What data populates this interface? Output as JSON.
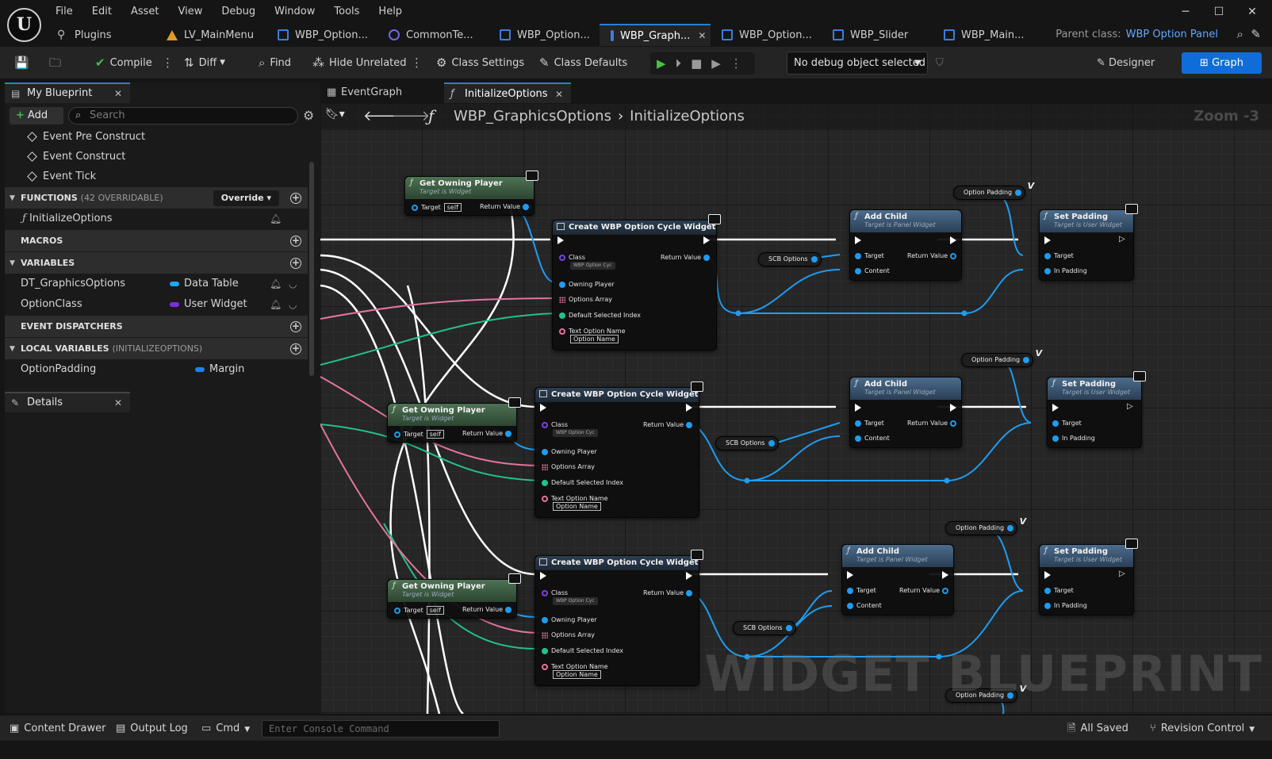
{
  "app": {
    "logo": "U",
    "menu": [
      "File",
      "Edit",
      "Asset",
      "View",
      "Debug",
      "Window",
      "Tools",
      "Help"
    ]
  },
  "tabs": [
    {
      "label": "Plugins",
      "icon": "plug-icon"
    },
    {
      "label": "LV_MainMenu",
      "icon": "level-icon"
    },
    {
      "label": "WBP_Option...",
      "icon": "blueprint-icon"
    },
    {
      "label": "CommonTe...",
      "icon": "common-icon"
    },
    {
      "label": "WBP_Option...",
      "icon": "blueprint-icon"
    },
    {
      "label": "WBP_Graph...",
      "icon": "blueprint-icon",
      "active": true
    },
    {
      "label": "WBP_Option...",
      "icon": "blueprint-icon"
    },
    {
      "label": "WBP_Slider",
      "icon": "blueprint-icon"
    },
    {
      "label": "WBP_Main...",
      "icon": "blueprint-icon"
    }
  ],
  "parent_class": {
    "label": "Parent class:",
    "value": "WBP Option Panel"
  },
  "toolbar": {
    "compile": "Compile",
    "diff": "Diff",
    "find": "Find",
    "hide_unrelated": "Hide Unrelated",
    "class_settings": "Class Settings",
    "class_defaults": "Class Defaults",
    "debug_object": "No debug object selected",
    "designer": "Designer",
    "graph": "Graph"
  },
  "my_blueprint": {
    "tab_label": "My Blueprint",
    "add_label": "Add",
    "search_placeholder": "Search",
    "events": [
      "Event Pre Construct",
      "Event Construct",
      "Event Tick"
    ],
    "functions_header": "FUNCTIONS",
    "functions_sub": "(42 OVERRIDABLE)",
    "override_label": "Override",
    "functions": [
      "InitializeOptions"
    ],
    "macros_header": "MACROS",
    "variables_header": "VARIABLES",
    "variables": [
      {
        "name": "DT_GraphicsOptions",
        "type": "Data Table",
        "color": "#1fa7f0"
      },
      {
        "name": "OptionClass",
        "type": "User Widget",
        "color": "#7a2ee0"
      }
    ],
    "dispatchers_header": "EVENT DISPATCHERS",
    "local_header": "LOCAL VARIABLES",
    "local_sub": "(INITIALIZEOPTIONS)",
    "local_variables": [
      {
        "name": "OptionPadding",
        "type": "Margin",
        "color": "#1f7ff0"
      }
    ]
  },
  "details": {
    "tab_label": "Details"
  },
  "graph": {
    "tabs": [
      {
        "label": "EventGraph"
      },
      {
        "label": "InitializeOptions",
        "active": true
      }
    ],
    "breadcrumb": [
      "WBP_GraphicsOptions",
      "InitializeOptions"
    ],
    "zoom": "Zoom -3",
    "watermark": "WIDGET BLUEPRINT",
    "nodes": {
      "get_owning_player": {
        "title": "Get Owning Player",
        "subtitle": "Target is Widget",
        "target": "Target",
        "self": "self",
        "ret": "Return Value"
      },
      "create_widget": {
        "title": "Create WBP Option Cycle Widget",
        "class": "Class",
        "class_value": "WBP Option Cyc",
        "ret": "Return Value",
        "owning_player": "Owning Player",
        "options_array": "Options Array",
        "default_index": "Default Selected Index",
        "text_option_name": "Text Option Name",
        "option_name_value": "Option Name"
      },
      "add_child": {
        "title": "Add Child",
        "subtitle": "Target is Panel Widget",
        "target": "Target",
        "content": "Content",
        "ret": "Return Value"
      },
      "set_padding": {
        "title": "Set Padding",
        "subtitle": "Target is User Widget",
        "target": "Target",
        "in_padding": "In Padding"
      },
      "var_option_padding": "Option Padding",
      "var_scb_options": "SCB Options"
    }
  },
  "status": {
    "content_drawer": "Content Drawer",
    "output_log": "Output Log",
    "cmd": "Cmd",
    "console_placeholder": "Enter Console Command",
    "all_saved": "All Saved",
    "revision_control": "Revision Control"
  },
  "colors": {
    "accent": "#0f6dda",
    "exec": "#ffffff",
    "object_pin": "#1f9cf0",
    "struct_pin": "#23c18b",
    "string_pin": "#e474a0",
    "class_pin": "#7a40e8"
  }
}
